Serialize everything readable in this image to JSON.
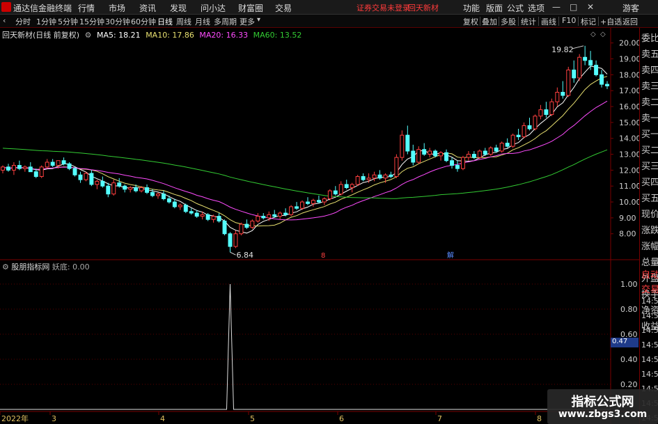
{
  "app": {
    "title": "通达信金融终端",
    "menu": [
      "行情",
      "市场",
      "资讯",
      "发现",
      "问小达",
      "财富圈",
      "交易"
    ],
    "notice": "证券交易未登录",
    "stock_name": "回天新材",
    "right_menu": [
      "功能",
      "版面",
      "公式",
      "选项"
    ],
    "guest": "游客"
  },
  "periodbar": {
    "periods": [
      "分时",
      "1分钟",
      "5分钟",
      "15分钟",
      "30分钟",
      "60分钟",
      "日线",
      "周线",
      "月线",
      "多周期",
      "更多"
    ],
    "active_period": "日线",
    "tools": [
      "复权",
      "叠加",
      "多股",
      "统计",
      "画线",
      "F10",
      "标记",
      "+自选",
      "返回"
    ]
  },
  "price_header": {
    "title": "回天新材(日线 前复权)",
    "ma5": "MA5: 18.21",
    "ma10": "MA10: 17.86",
    "ma20": "MA20: 16.33",
    "ma60": "MA60: 13.52",
    "colors": {
      "ma5": "#ffffff",
      "ma10": "#e8e070",
      "ma20": "#ff4cff",
      "ma60": "#33cc33"
    }
  },
  "indicator_header": {
    "name": "股朋指标网",
    "value": "妖底: 0.00"
  },
  "annotations": {
    "high": "19.82",
    "low": "6.84",
    "mark1": "8",
    "mark2": "解"
  },
  "pick_value": "0.47",
  "x_axis": [
    "2022年",
    "3",
    "4",
    "5",
    "6",
    "7",
    "8"
  ],
  "price_ticks": [
    "20.00",
    "19.00",
    "18.00",
    "17.00",
    "16.00",
    "15.00",
    "14.00",
    "13.00",
    "12.00",
    "11.00",
    "10.00",
    "9.00",
    "8.00"
  ],
  "ind_ticks": [
    "1.00",
    "0.80",
    "0.60",
    "0.40",
    "0.20"
  ],
  "quote_labels": [
    "委比",
    "卖五",
    "卖四",
    "卖三",
    "卖二",
    "卖一",
    "买一",
    "买二",
    "买三",
    "买四",
    "买五",
    "现价",
    "涨跌",
    "涨幅",
    "总量",
    "外盘",
    "换手",
    "净资",
    "收益"
  ],
  "quote_lower": [
    "自动",
    "交易",
    "14:56",
    "14:56",
    "14:56",
    "14:56",
    "14:56",
    "14:56",
    "14:56",
    "14:56",
    "14:56"
  ],
  "watermark": {
    "title": "指标公式网",
    "url": "www.zbgs3.com"
  },
  "colors": {
    "up": "#ff4040",
    "down": "#54ffff",
    "grid": "#7a0000",
    "axis_text": "#d0d0d0"
  },
  "chart_data": {
    "type": "candlestick",
    "price_range": [
      6.5,
      20.6
    ],
    "ind_range": [
      0,
      1.1
    ],
    "candles": [
      [
        12.0,
        12.3,
        11.8,
        12.2
      ],
      [
        12.2,
        12.4,
        11.9,
        12.0
      ],
      [
        12.0,
        12.5,
        11.7,
        12.3
      ],
      [
        12.3,
        12.6,
        12.0,
        12.1
      ],
      [
        12.1,
        12.3,
        11.9,
        12.2
      ],
      [
        12.2,
        12.5,
        12.0,
        11.9
      ],
      [
        11.9,
        12.1,
        11.5,
        11.6
      ],
      [
        11.6,
        12.3,
        11.5,
        12.2
      ],
      [
        12.2,
        12.7,
        12.1,
        12.5
      ],
      [
        12.5,
        12.7,
        12.2,
        12.3
      ],
      [
        12.3,
        12.6,
        12.1,
        12.6
      ],
      [
        12.6,
        12.8,
        12.3,
        12.4
      ],
      [
        12.4,
        12.5,
        12.0,
        12.1
      ],
      [
        12.1,
        12.2,
        11.6,
        11.7
      ],
      [
        11.7,
        11.9,
        11.2,
        11.4
      ],
      [
        11.4,
        11.9,
        11.3,
        11.8
      ],
      [
        11.8,
        12.0,
        11.0,
        11.1
      ],
      [
        11.1,
        11.4,
        10.8,
        11.3
      ],
      [
        11.3,
        11.6,
        10.9,
        11.0
      ],
      [
        11.0,
        11.2,
        10.3,
        10.5
      ],
      [
        10.5,
        11.4,
        10.4,
        11.2
      ],
      [
        11.2,
        11.5,
        10.9,
        11.0
      ],
      [
        11.0,
        11.1,
        10.6,
        10.8
      ],
      [
        10.8,
        11.0,
        10.6,
        10.9
      ],
      [
        10.9,
        11.1,
        10.6,
        10.7
      ],
      [
        10.7,
        11.0,
        10.6,
        10.9
      ],
      [
        10.9,
        11.1,
        10.5,
        10.6
      ],
      [
        10.6,
        10.8,
        10.3,
        10.4
      ],
      [
        10.4,
        10.6,
        10.2,
        10.5
      ],
      [
        10.5,
        10.7,
        10.1,
        10.2
      ],
      [
        10.2,
        10.4,
        9.9,
        10.0
      ],
      [
        10.0,
        10.2,
        9.6,
        9.7
      ],
      [
        9.7,
        9.9,
        9.5,
        9.8
      ],
      [
        9.8,
        9.9,
        9.3,
        9.4
      ],
      [
        9.4,
        9.6,
        9.2,
        9.3
      ],
      [
        9.3,
        9.5,
        9.0,
        9.1
      ],
      [
        9.1,
        9.4,
        8.9,
        9.2
      ],
      [
        9.2,
        9.3,
        8.8,
        8.9
      ],
      [
        8.9,
        9.2,
        8.7,
        9.1
      ],
      [
        9.1,
        9.3,
        8.7,
        8.8
      ],
      [
        8.8,
        8.9,
        7.9,
        8.0
      ],
      [
        8.0,
        8.1,
        6.84,
        7.2
      ],
      [
        7.2,
        8.2,
        7.1,
        8.0
      ],
      [
        8.0,
        8.7,
        7.9,
        8.6
      ],
      [
        8.6,
        8.9,
        8.3,
        8.4
      ],
      [
        8.4,
        8.9,
        8.3,
        8.8
      ],
      [
        8.8,
        9.3,
        8.7,
        9.1
      ],
      [
        9.1,
        9.3,
        8.9,
        9.0
      ],
      [
        9.0,
        9.4,
        8.8,
        9.2
      ],
      [
        9.2,
        9.5,
        9.0,
        9.1
      ],
      [
        9.1,
        9.4,
        8.9,
        9.3
      ],
      [
        9.3,
        9.6,
        9.1,
        9.2
      ],
      [
        9.2,
        9.8,
        9.1,
        9.7
      ],
      [
        9.7,
        10.0,
        9.5,
        9.6
      ],
      [
        9.6,
        10.1,
        9.5,
        10.0
      ],
      [
        10.0,
        10.3,
        9.8,
        9.9
      ],
      [
        9.9,
        10.2,
        9.7,
        10.1
      ],
      [
        10.1,
        10.4,
        9.9,
        10.0
      ],
      [
        10.0,
        10.3,
        9.8,
        10.2
      ],
      [
        10.2,
        10.8,
        10.1,
        10.7
      ],
      [
        10.7,
        11.0,
        10.4,
        10.5
      ],
      [
        10.5,
        11.3,
        10.4,
        11.1
      ],
      [
        11.1,
        11.4,
        10.8,
        10.9
      ],
      [
        10.9,
        11.2,
        10.6,
        11.1
      ],
      [
        11.1,
        11.7,
        11.0,
        11.6
      ],
      [
        11.6,
        11.8,
        11.3,
        11.4
      ],
      [
        11.4,
        11.8,
        11.2,
        11.5
      ],
      [
        11.5,
        11.9,
        11.3,
        11.7
      ],
      [
        11.7,
        12.0,
        11.4,
        11.5
      ],
      [
        11.5,
        11.8,
        11.2,
        11.7
      ],
      [
        11.7,
        11.9,
        11.5,
        11.6
      ],
      [
        11.6,
        13.0,
        11.5,
        12.8
      ],
      [
        12.8,
        14.5,
        12.6,
        14.2
      ],
      [
        14.2,
        14.8,
        13.0,
        13.2
      ],
      [
        13.2,
        13.6,
        12.3,
        12.5
      ],
      [
        12.5,
        13.5,
        12.4,
        13.3
      ],
      [
        13.3,
        13.7,
        12.9,
        13.0
      ],
      [
        13.0,
        13.4,
        12.8,
        13.2
      ],
      [
        13.2,
        13.3,
        12.8,
        12.9
      ],
      [
        12.9,
        13.2,
        12.6,
        13.1
      ],
      [
        13.1,
        13.3,
        12.5,
        12.6
      ],
      [
        12.6,
        12.8,
        12.1,
        12.3
      ],
      [
        12.3,
        12.6,
        11.9,
        12.1
      ],
      [
        12.1,
        12.9,
        12.0,
        12.8
      ],
      [
        12.8,
        13.2,
        12.6,
        13.0
      ],
      [
        13.0,
        13.2,
        12.7,
        12.8
      ],
      [
        12.8,
        13.3,
        12.7,
        13.2
      ],
      [
        13.2,
        13.4,
        12.9,
        13.0
      ],
      [
        13.0,
        13.5,
        12.9,
        13.4
      ],
      [
        13.4,
        13.6,
        13.1,
        13.2
      ],
      [
        13.2,
        13.8,
        13.1,
        13.7
      ],
      [
        13.7,
        14.0,
        13.4,
        13.5
      ],
      [
        13.5,
        14.3,
        13.4,
        14.2
      ],
      [
        14.2,
        14.6,
        13.9,
        14.1
      ],
      [
        14.1,
        15.0,
        14.0,
        14.8
      ],
      [
        14.8,
        15.3,
        14.5,
        14.6
      ],
      [
        14.6,
        15.5,
        14.5,
        15.4
      ],
      [
        15.4,
        16.1,
        15.2,
        15.8
      ],
      [
        15.8,
        16.3,
        15.3,
        15.5
      ],
      [
        15.5,
        16.5,
        15.4,
        16.3
      ],
      [
        16.3,
        17.2,
        16.0,
        16.9
      ],
      [
        16.9,
        17.6,
        16.5,
        16.7
      ],
      [
        16.7,
        18.5,
        16.6,
        18.3
      ],
      [
        18.3,
        18.9,
        17.5,
        17.8
      ],
      [
        17.8,
        19.3,
        17.6,
        19.1
      ],
      [
        19.1,
        19.82,
        18.6,
        18.9
      ],
      [
        18.9,
        19.5,
        18.3,
        18.6
      ],
      [
        18.6,
        18.9,
        17.9,
        18.0
      ],
      [
        18.0,
        18.3,
        17.2,
        17.4
      ],
      [
        17.4,
        17.6,
        17.1,
        17.3
      ]
    ],
    "ind_spike_index": 41,
    "ind_spike_value": 1.0
  }
}
